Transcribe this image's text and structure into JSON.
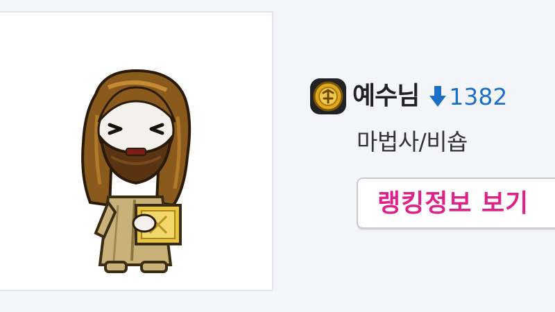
{
  "character": {
    "name": "예수님",
    "job": "마법사/비숍",
    "rank_change": "1382",
    "rank_direction": "down",
    "world_icon": "gold-coin-world-icon"
  },
  "buttons": {
    "ranking_info": "랭킹정보 보기"
  },
  "colors": {
    "rank_change": "#1b6fc8",
    "ranking_button_text": "#e0218a",
    "name_text": "#222222"
  }
}
